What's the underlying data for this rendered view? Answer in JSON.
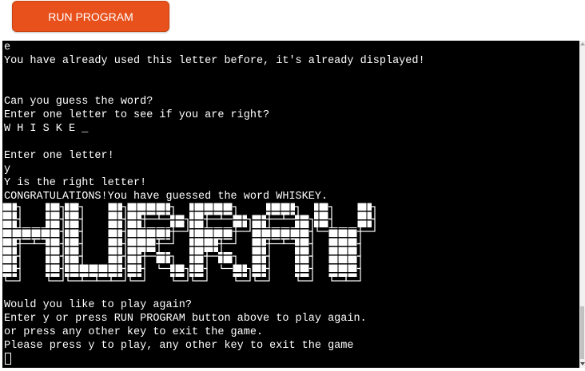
{
  "toolbar": {
    "run_label": "RUN PROGRAM"
  },
  "terminal": {
    "lines": [
      "e",
      "You have already used this letter before, it's already displayed!",
      "",
      "",
      "Can you guess the word?",
      "Enter one letter to see if you are right?",
      "W H I S K E _",
      "",
      "Enter one letter!",
      "y",
      "Y is the right letter!",
      "CONGRATULATIONS!You have guessed the word WHISKEY."
    ],
    "banner_text": "HURRAY",
    "lines_after": [
      "Would you like to play again?",
      "Enter y or press RUN PROGRAM button above to play again.",
      "or press any other key to exit the game.",
      "Please press y to play, any other key to exit the game"
    ]
  },
  "colors": {
    "button_bg": "#e8501c",
    "terminal_bg": "#000000",
    "terminal_fg": "#ffffff"
  }
}
